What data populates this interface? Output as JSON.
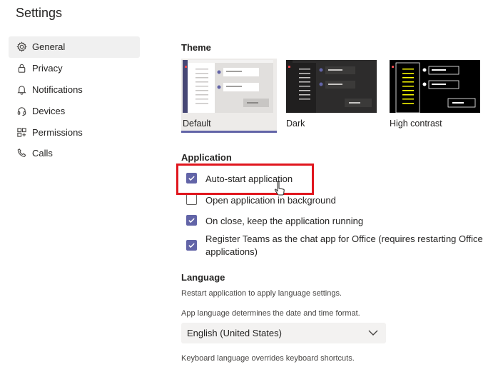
{
  "window": {
    "title": "Settings"
  },
  "sidebar": {
    "items": [
      {
        "label": "General",
        "icon": "gear-icon",
        "active": true
      },
      {
        "label": "Privacy",
        "icon": "lock-icon",
        "active": false
      },
      {
        "label": "Notifications",
        "icon": "bell-icon",
        "active": false
      },
      {
        "label": "Devices",
        "icon": "headset-icon",
        "active": false
      },
      {
        "label": "Permissions",
        "icon": "grid-icon",
        "active": false
      },
      {
        "label": "Calls",
        "icon": "phone-icon",
        "active": false
      }
    ]
  },
  "theme": {
    "heading": "Theme",
    "options": [
      {
        "label": "Default",
        "selected": true
      },
      {
        "label": "Dark",
        "selected": false
      },
      {
        "label": "High contrast",
        "selected": false
      }
    ]
  },
  "application": {
    "heading": "Application",
    "options": [
      {
        "label": "Auto-start application",
        "checked": true
      },
      {
        "label": "Open application in background",
        "checked": false
      },
      {
        "label": "On close, keep the application running",
        "checked": true
      },
      {
        "label": "Register Teams as the chat app for Office (requires restarting Office applications)",
        "checked": true
      }
    ]
  },
  "language": {
    "heading": "Language",
    "restart_note": "Restart application to apply language settings.",
    "app_language_note": "App language determines the date and time format.",
    "selected": "English (United States)",
    "keyboard_note": "Keyboard language overrides keyboard shortcuts."
  },
  "colors": {
    "accent": "#6264a7",
    "highlight_box": "#e0161e"
  }
}
